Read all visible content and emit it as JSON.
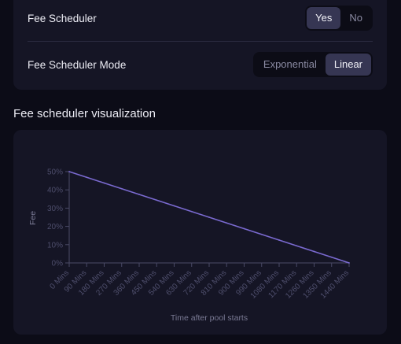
{
  "settings": {
    "fee_scheduler": {
      "label": "Fee Scheduler",
      "options": [
        "Yes",
        "No"
      ],
      "selected": "Yes"
    },
    "fee_scheduler_mode": {
      "label": "Fee Scheduler Mode",
      "options": [
        "Exponential",
        "Linear"
      ],
      "selected": "Linear"
    }
  },
  "visualization": {
    "title": "Fee scheduler visualization"
  },
  "colors": {
    "line": "#7a6ad0",
    "axis": "#4a4a66",
    "active_segment": "#363653"
  },
  "chart_data": {
    "type": "line",
    "title": "",
    "xlabel": "Time after pool starts",
    "ylabel": "Fee",
    "categories": [
      "0 Mins",
      "90 Mins",
      "180 Mins",
      "270 Mins",
      "360 Mins",
      "450 Mins",
      "540 Mins",
      "630 Mins",
      "720 Mins",
      "810 Mins",
      "900 Mins",
      "990 Mins",
      "1080 Mins",
      "1170 Mins",
      "1260 Mins",
      "1350 Mins",
      "1440 Mins"
    ],
    "y_ticks": [
      "0%",
      "10%",
      "20%",
      "30%",
      "40%",
      "50%"
    ],
    "ylim": [
      0,
      50
    ],
    "series": [
      {
        "values": [
          50,
          46.875,
          43.75,
          40.625,
          37.5,
          34.375,
          31.25,
          28.125,
          25,
          21.875,
          18.75,
          15.625,
          12.5,
          9.375,
          6.25,
          3.125,
          0
        ]
      }
    ],
    "grid": false,
    "legend": "none"
  }
}
